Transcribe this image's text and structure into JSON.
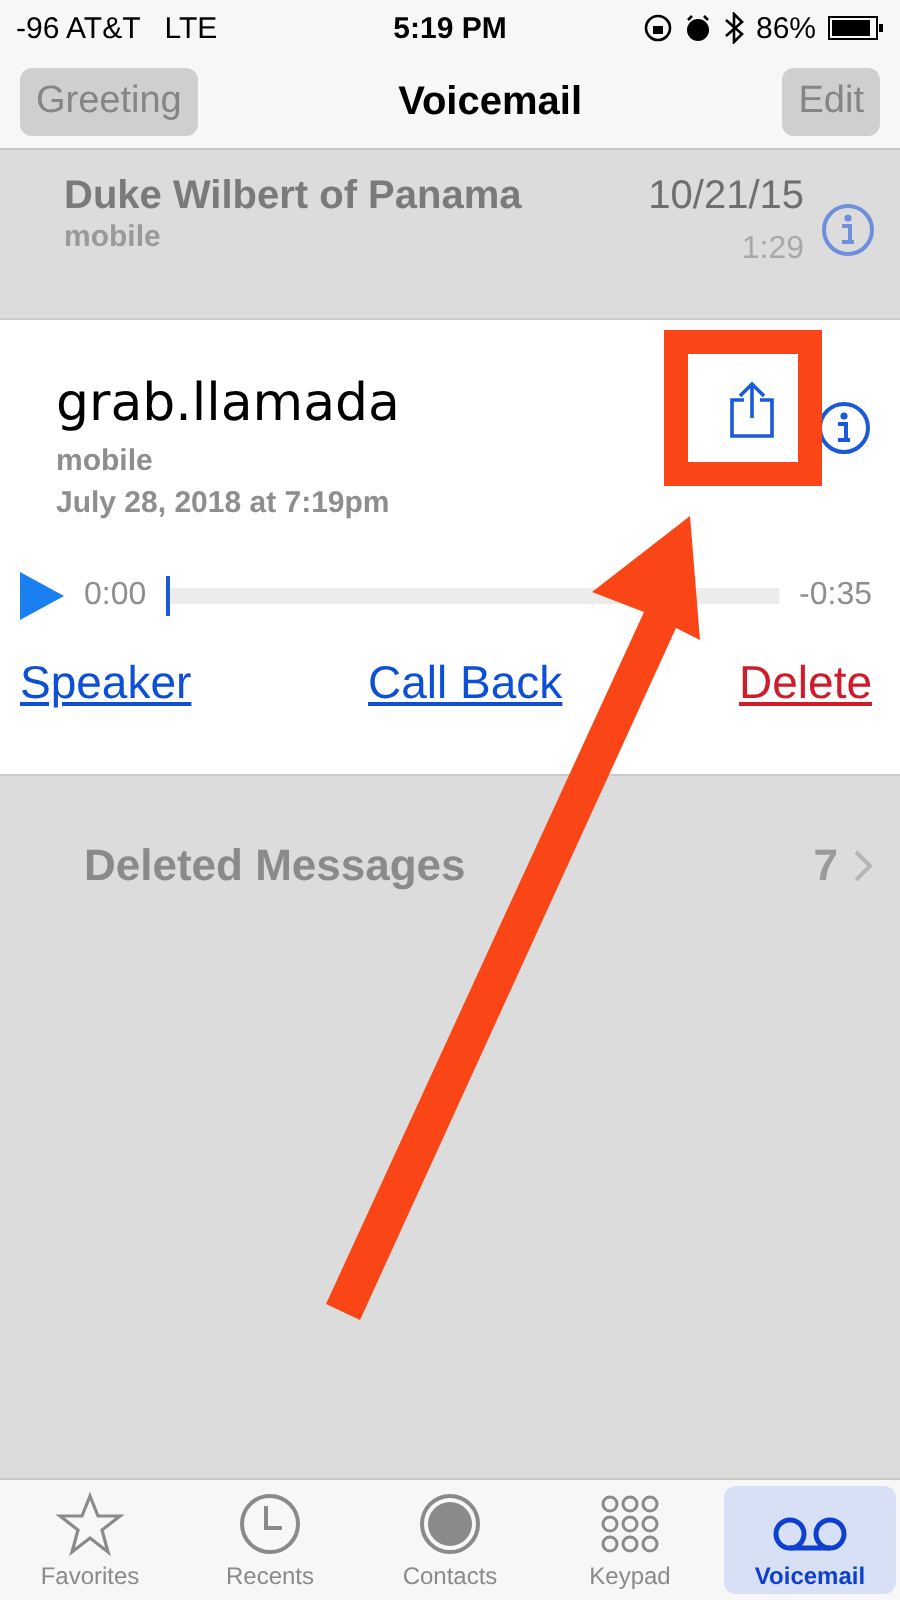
{
  "status_bar": {
    "carrier": "-96 AT&T",
    "network": "LTE",
    "time": "5:19 PM",
    "battery": "86%"
  },
  "nav": {
    "left_button": "Greeting",
    "title": "Voicemail",
    "right_button": "Edit"
  },
  "messages": [
    {
      "name": "Duke Wilbert of Panama",
      "label": "mobile",
      "date": "10/21/15",
      "duration": "1:29",
      "expanded": false
    },
    {
      "name": "grab.llamada",
      "label": "mobile",
      "date": "July 28, 2018 at 7:19pm",
      "expanded": true,
      "elapsed": "0:00",
      "remaining": "-0:35",
      "level": 0,
      "actions": [
        {
          "label": "Speaker",
          "kind": "normal"
        },
        {
          "label": "Call Back",
          "kind": "normal"
        },
        {
          "label": "Delete",
          "kind": "destructive"
        }
      ]
    }
  ],
  "deleted": {
    "label": "Deleted Messages",
    "count": "7"
  },
  "tabs": [
    {
      "label": "Favorites",
      "kind": "star",
      "selected": false
    },
    {
      "label": "Recents",
      "kind": "clock",
      "selected": false
    },
    {
      "label": "Contacts",
      "kind": "person",
      "selected": false
    },
    {
      "label": "Keypad",
      "kind": "keypad",
      "selected": false
    },
    {
      "label": "Voicemail",
      "kind": "voicemail",
      "selected": true
    }
  ]
}
